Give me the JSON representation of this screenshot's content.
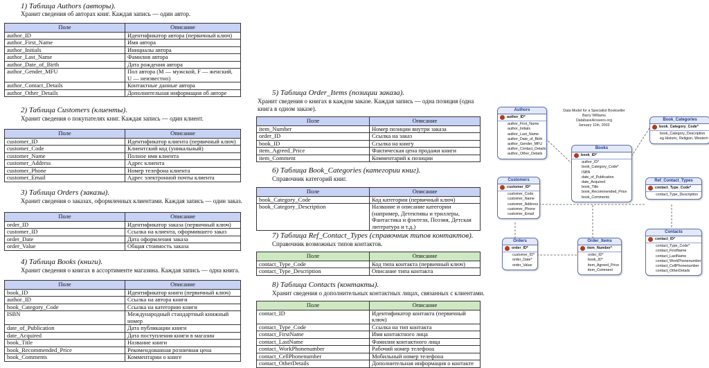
{
  "sections": {
    "authors": {
      "heading": "1) Таблица Authors (авторы).",
      "desc": "Хранит сведения об авторах книг. Каждая запись — один автор.",
      "col_field": "Поле",
      "col_desc": "Описание",
      "rows": [
        [
          "author_ID",
          "Идентификатор автора (первичный ключ)"
        ],
        [
          "author_First_Name",
          "Имя автора"
        ],
        [
          "author_Initials",
          "Инициалы автора"
        ],
        [
          "author_Last_Name",
          "Фамилия автора"
        ],
        [
          "author_Date_of_Birth",
          "Дата рождения автора"
        ],
        [
          "author_Gender_MFU",
          "Пол автора (M — мужской, F — женский, U — неизвестно)"
        ],
        [
          "author_Contact_Details",
          "Контактные данные автора"
        ],
        [
          "author_Other_Details",
          "Дополнительная информация об авторе"
        ]
      ]
    },
    "customers": {
      "heading": "2) Таблица Customers (клиенты).",
      "desc": "Хранит сведения о покупателях книг. Каждая запись — один клиент.",
      "col_field": "Поле",
      "col_desc": "Описание",
      "rows": [
        [
          "customer_ID",
          "Идентификатор клиента (первичный ключ)"
        ],
        [
          "customer_Code",
          "Клиентский код (уникальный)"
        ],
        [
          "customer_Name",
          "Полное имя клиента"
        ],
        [
          "customer_Address",
          "Адрес клиента"
        ],
        [
          "customer_Phone",
          "Номер телефона клиента"
        ],
        [
          "customer_Email",
          "Адрес электронной почты клиента"
        ]
      ]
    },
    "orders": {
      "heading": "3) Таблица Orders (заказы).",
      "desc": "Хранит сведения о заказах, оформленных клиентами. Каждая запись — один заказ.",
      "col_field": "Поле",
      "col_desc": "Описание",
      "rows": [
        [
          "order_ID",
          "Идентификатор заказа (первичный ключ)"
        ],
        [
          "customer_ID",
          "Ссылка на клиента, оформившего заказ"
        ],
        [
          "order_Date",
          "Дата оформления заказа"
        ],
        [
          "order_Value",
          "Общая стоимость заказа"
        ]
      ]
    },
    "books": {
      "heading": "4) Таблица Books (книги).",
      "desc": "Хранит сведения о книгах в ассортименте магазина. Каждая запись — одна книга.",
      "col_field": "Поле",
      "col_desc": "Описание",
      "rows": [
        [
          "book_ID",
          "Идентификатор книги (первичный ключ)"
        ],
        [
          "author_ID",
          "Ссылка на автора книги"
        ],
        [
          "book_Category_Code",
          "Ссылка на категорию книги"
        ],
        [
          "ISBN",
          "Международный стандартный книжный номер"
        ],
        [
          "date_of_Publication",
          "Дата публикации книги"
        ],
        [
          "date_Acquired",
          "Дата поступления книги в магазин"
        ],
        [
          "book_Title",
          "Название книги"
        ],
        [
          "book_Recommended_Price",
          "Рекомендованная розничная цена"
        ],
        [
          "book_Comments",
          "Комментарии о книге"
        ]
      ]
    },
    "order_items": {
      "heading": "5) Таблица Order_Items (позиции заказа).",
      "desc": "Хранит сведения о книгах в каждом заказе. Каждая запись — одна позиция (одна книга в одном заказе).",
      "col_field": "Поле",
      "col_desc": "Описание",
      "rows": [
        [
          "item_Number",
          "Номер позиции внутри заказа"
        ],
        [
          "order_ID",
          "Ссылка на заказ"
        ],
        [
          "book_ID",
          "Ссылка на книгу"
        ],
        [
          "item_Agreed_Price",
          "Фактическая цена продажи книги"
        ],
        [
          "item_Comment",
          "Комментарий к позиции"
        ]
      ]
    },
    "book_categories": {
      "heading": "6) Таблица Book_Categories (категории книг).",
      "desc": "Справочник категорий книг.",
      "col_field": "Поле",
      "col_desc": "Описание",
      "rows": [
        [
          "book_Category_Code",
          "Код категории (первичный ключ)"
        ],
        [
          "book_Category_Description",
          "Название и описание категории (например, Детективы и триллеры, Фантастика и фэнтези, Поэзия, Детская литература и т.д.)"
        ]
      ]
    },
    "ref_contact_types": {
      "heading": "7) Таблица Ref_Contact_Types (справочник типов контактов).",
      "desc": "Справочник возможных типов контактов.",
      "col_field": "Поле",
      "col_desc": "Описание",
      "rows": [
        [
          "contact_Type_Code",
          "Код типа контакта (первичный ключ)"
        ],
        [
          "contact_Type_Description",
          "Описание типа контакта"
        ]
      ]
    },
    "contacts": {
      "heading": "8) Таблица Contacts (контакты).",
      "desc": "Хранит сведения о дополнительных контактных лицах, связанных с клиентами.",
      "col_field": "Поле",
      "col_desc": "Описание",
      "rows": [
        [
          "contact_ID",
          "Идентификатор контакта (первичный ключ)"
        ],
        [
          "contact_Type_Code",
          "Ссылка на тип контакта"
        ],
        [
          "contact_FirstName",
          "Имя контактного лица"
        ],
        [
          "contact_LastName",
          "Фамилия контактного лица"
        ],
        [
          "contact_WorkPhonenumber",
          "Рабочий номер телефона"
        ],
        [
          "contact_CellPhonenumber",
          "Мобильный номер телефона"
        ],
        [
          "contact_OtherDetails",
          "Дополнительная информация о контакте"
        ]
      ]
    }
  },
  "diagram": {
    "note": [
      "Data Model for a Specialist Bookseller",
      "Barry Williams",
      "DatabaseAnswers.org",
      "January 11th, 2003"
    ],
    "entities": {
      "authors": {
        "title": "Authors",
        "pk": "author_ID*",
        "fields": [
          "author_First_Name",
          "author_Initials",
          "author_Last_Name",
          "author_Date_of_Birth",
          "author_Gender_MFU",
          "author_Contact_Details",
          "author_Other_Details"
        ]
      },
      "book_categories": {
        "title": "Book_Categories",
        "pk": "book_Category_Code*",
        "fields": [
          "book_Category_Description",
          "eg Historic, Religion, Western"
        ]
      },
      "books": {
        "title": "Books",
        "pk": "book_ID*",
        "fields": [
          "author_ID*",
          "book_Category_Code*",
          "ISBN",
          "date_of_Publication",
          "date_Acquired",
          "book_Title",
          "book_Recommended_Price",
          "book_Comments"
        ]
      },
      "customers": {
        "title": "Customers",
        "pk": "customer_ID*",
        "fields": [
          "customer_Code",
          "customer_Name",
          "customer_Address",
          "customer_Phone",
          "customer_Email"
        ]
      },
      "ref_contact_types": {
        "title": "Ref_Contact_Types",
        "pk": "contact_Type_Code*",
        "fields": [
          "contact_Type_Description"
        ]
      },
      "orders": {
        "title": "Orders",
        "pk": "order_ID*",
        "fields": [
          "customer_ID*",
          "order_Date*",
          "order_Value"
        ]
      },
      "order_items": {
        "title": "Order_Items",
        "pk": "item_Number*",
        "fields": [
          "order_ID*",
          "book_ID*",
          "item_Agreed_Price",
          "item_Comment"
        ]
      },
      "contacts": {
        "title": "Contacts",
        "pk": "contact_ID*",
        "fields": [
          "contact_Type_Code*",
          "contact_FirstName",
          "contact_LastName",
          "contact_WorkPhonenumber",
          "contact_CellPhonenumber",
          "contact_OtherDetails"
        ]
      }
    }
  },
  "colors": {
    "header_blue": "#c8d2f5",
    "header_green": "#cfe8c4",
    "entity_border": "#5b6fa8",
    "key_red": "#b23b1c"
  }
}
